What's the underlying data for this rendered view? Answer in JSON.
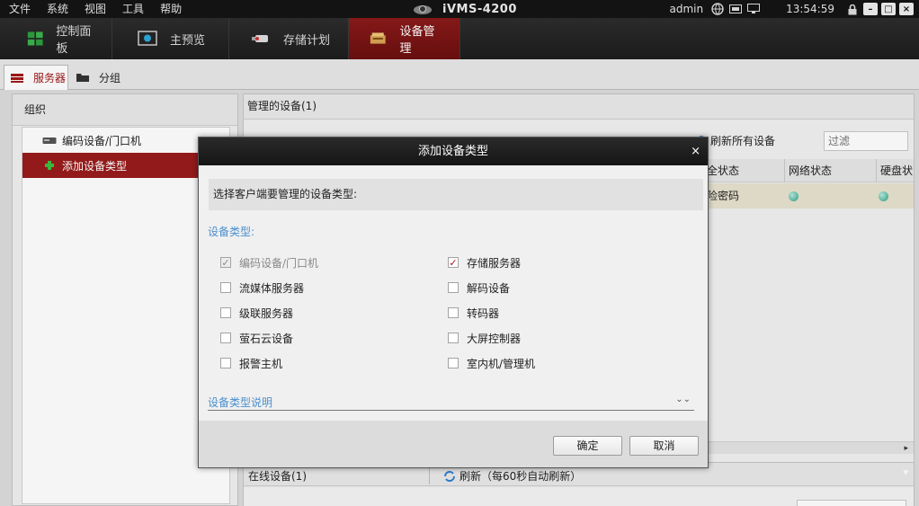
{
  "menubar": {
    "menus": [
      "文件",
      "系统",
      "视图",
      "工具",
      "帮助"
    ],
    "app_title": "iVMS-4200",
    "user": "admin",
    "time": "13:54:59",
    "icons": [
      "network-icon",
      "keyboard-icon",
      "monitor-icon",
      "lock-icon"
    ]
  },
  "modules": {
    "tabs": [
      {
        "label": "控制面板"
      },
      {
        "label": "主预览"
      },
      {
        "label": "存储计划"
      },
      {
        "label": "设备管理"
      }
    ],
    "active": "设备管理"
  },
  "subtabs": {
    "server": "服务器",
    "group": "分组"
  },
  "left_panel": {
    "header": "组织",
    "items": [
      {
        "label": "编码设备/门口机"
      },
      {
        "label": "添加设备类型"
      }
    ]
  },
  "right_panel": {
    "header": "管理的设备(1)",
    "refresh_all": "刷新所有设备",
    "filter_placeholder": "过滤",
    "columns": [
      "全状态",
      "网络状态",
      "硬盘状"
    ],
    "row": {
      "security": "险密码"
    }
  },
  "bottom_panel": {
    "online": "在线设备(1)",
    "refresh": "刷新（每60秒自动刷新）"
  },
  "dialog": {
    "title": "添加设备类型",
    "close": "×",
    "prompt": "选择客户端要管理的设备类型:",
    "section_title": "设备类型:",
    "options_left": [
      {
        "label": "编码设备/门口机",
        "checked": true,
        "disabled": true
      },
      {
        "label": "流媒体服务器",
        "checked": false
      },
      {
        "label": "级联服务器",
        "checked": false
      },
      {
        "label": "萤石云设备",
        "checked": false
      },
      {
        "label": "报警主机",
        "checked": false
      }
    ],
    "options_right": [
      {
        "label": "存储服务器",
        "checked": true
      },
      {
        "label": "解码设备",
        "checked": false
      },
      {
        "label": "转码器",
        "checked": false
      },
      {
        "label": "大屏控制器",
        "checked": false
      },
      {
        "label": "室内机/管理机",
        "checked": false
      }
    ],
    "description_toggle": "设备类型说明",
    "ok": "确定",
    "cancel": "取消"
  }
}
